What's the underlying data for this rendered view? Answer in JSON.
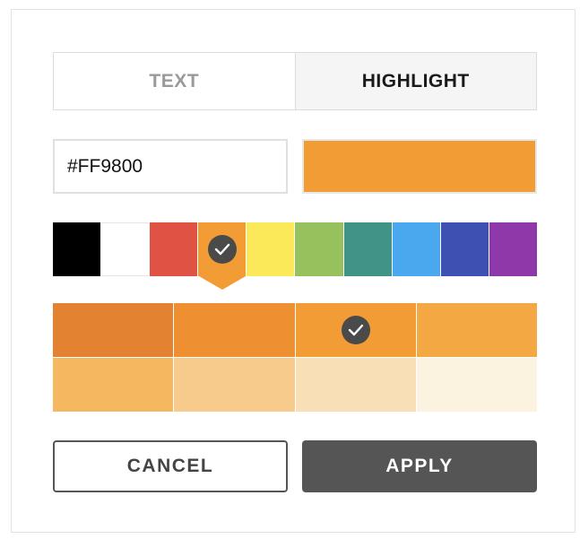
{
  "tabs": {
    "text_label": "TEXT",
    "highlight_label": "HIGHLIGHT",
    "active": "highlight"
  },
  "hex_input": {
    "value": "#FF9800"
  },
  "preview_color": "#F19C35",
  "palette": {
    "selected_index": 3,
    "colors": [
      "#000000",
      "#FFFFFF",
      "#E05243",
      "#F19C35",
      "#FCE95A",
      "#97C15C",
      "#3F9387",
      "#4AA8EF",
      "#3E51B2",
      "#8F38AA"
    ]
  },
  "shades": {
    "selected_index": 2,
    "colors": [
      "#E38331",
      "#EE8F31",
      "#F19C35",
      "#F3A844",
      "#F5B860",
      "#F6CB8C",
      "#F8DFB5",
      "#FBF2E0"
    ]
  },
  "buttons": {
    "cancel_label": "CANCEL",
    "apply_label": "APPLY"
  },
  "icons": {
    "selected": "checkmark-icon"
  }
}
